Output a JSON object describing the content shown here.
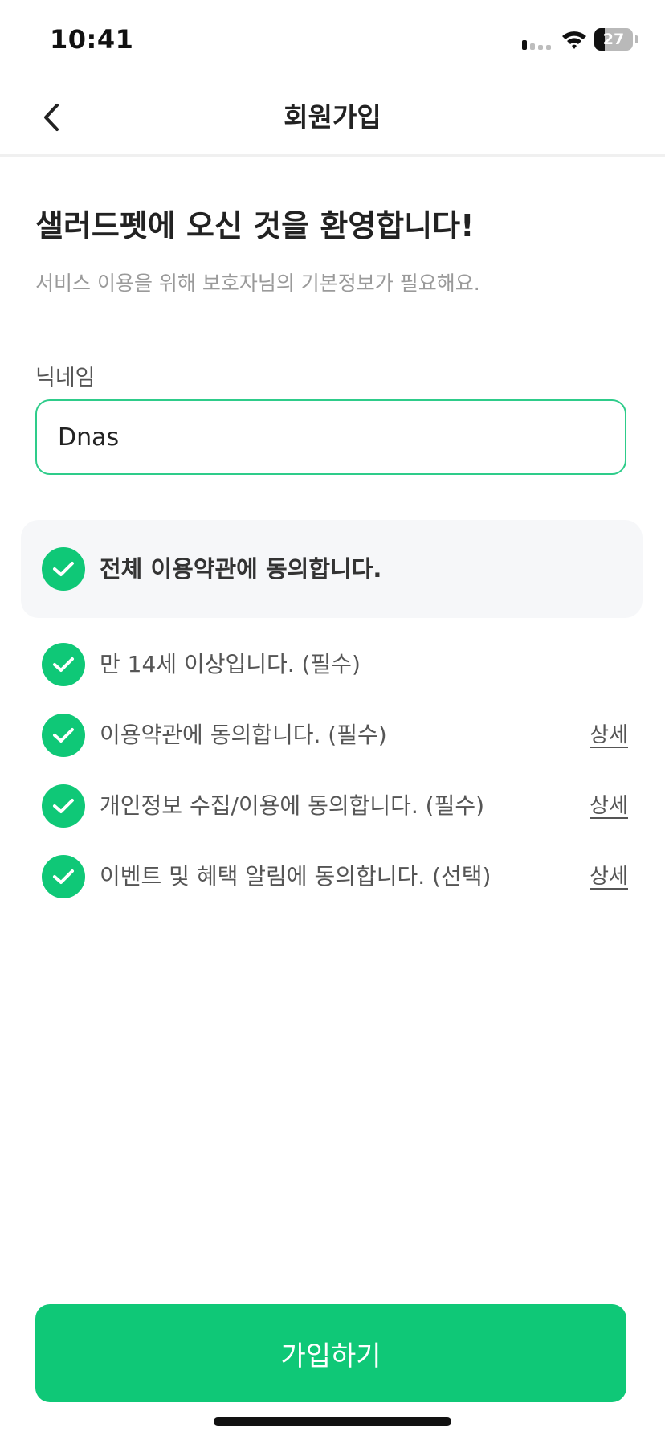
{
  "status_bar": {
    "time": "10:41",
    "battery_level": "27",
    "battery_fraction": 0.27
  },
  "nav": {
    "title": "회원가입",
    "back_icon": "chevron-left-icon"
  },
  "welcome": {
    "title": "샐러드펫에 오신 것을 환영합니다!",
    "subtitle": "서비스 이용을 위해 보호자님의 기본정보가 필요해요."
  },
  "nickname": {
    "label": "닉네임",
    "value": "Dnas"
  },
  "agreements": {
    "all": {
      "label": "전체 이용약관에 동의합니다.",
      "checked": true
    },
    "items": [
      {
        "label": "만 14세 이상입니다. (필수)",
        "checked": true,
        "detail": ""
      },
      {
        "label": "이용약관에 동의합니다. (필수)",
        "checked": true,
        "detail": "상세"
      },
      {
        "label": "개인정보 수집/이용에 동의합니다. (필수)",
        "checked": true,
        "detail": "상세"
      },
      {
        "label": "이벤트 및 혜택 알림에 동의합니다. (선택)",
        "checked": true,
        "detail": "상세"
      }
    ]
  },
  "submit": {
    "label": "가입하기"
  },
  "colors": {
    "accent": "#0fc877",
    "input_border": "#2ecc8a",
    "agree_all_bg": "#f6f7f9"
  }
}
